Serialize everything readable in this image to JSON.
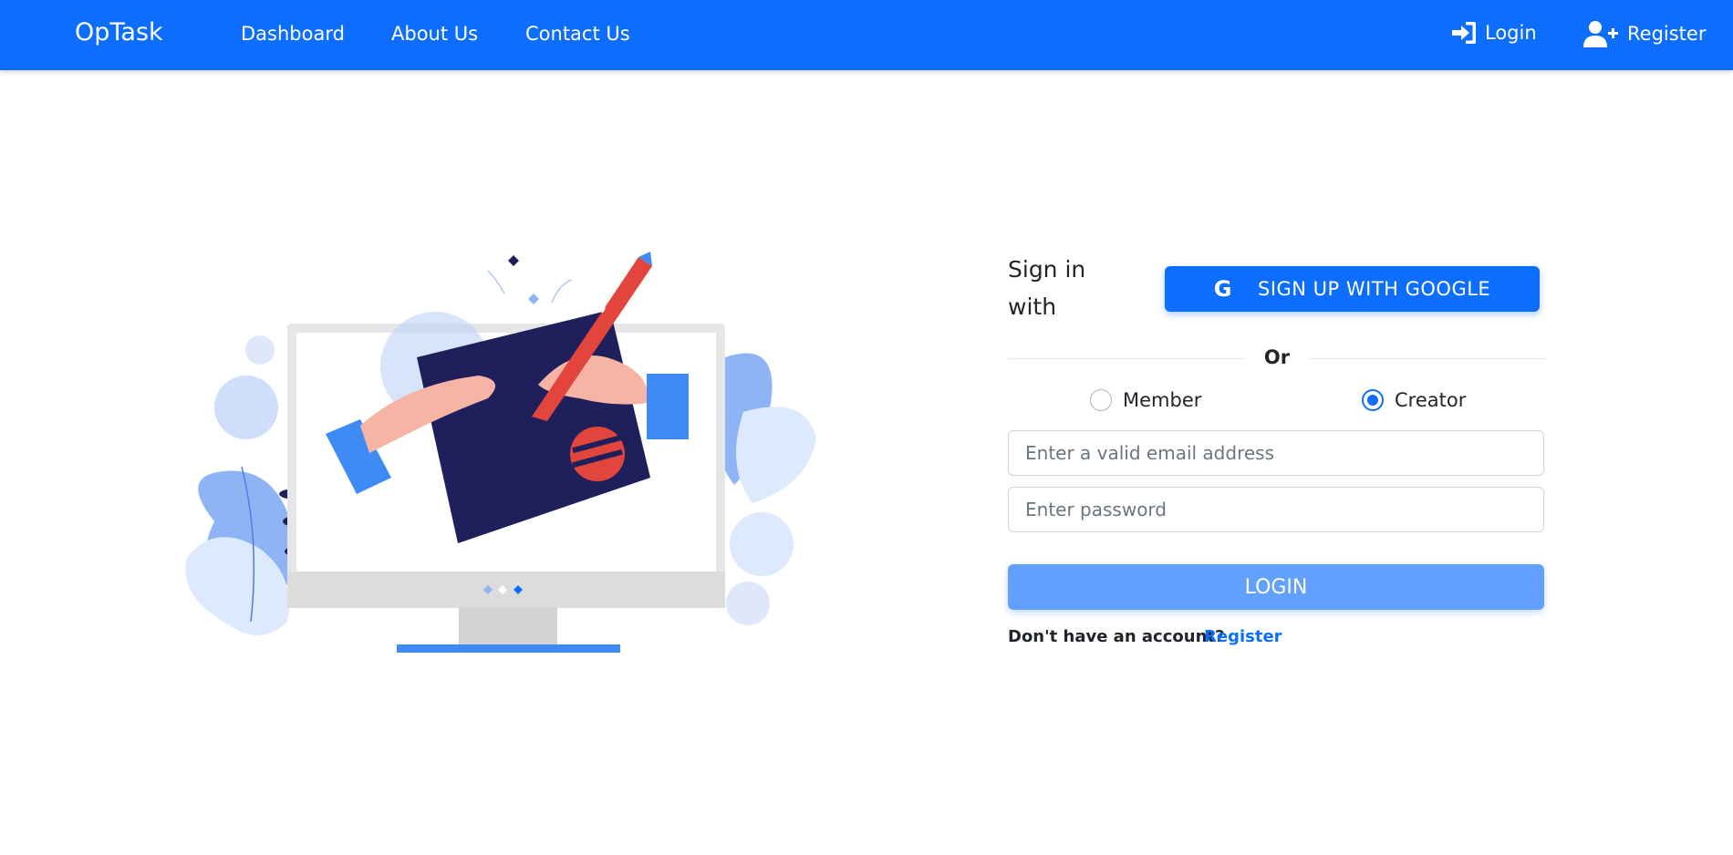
{
  "nav": {
    "brand": "OpTask",
    "links": [
      "Dashboard",
      "About Us",
      "Contact Us"
    ],
    "login_label": "Login",
    "register_label": "Register"
  },
  "form": {
    "signin_label": "Sign in with",
    "google_icon_letter": "G",
    "google_label": "SIGN UP WITH GOOGLE",
    "divider_text": "Or",
    "roles": [
      {
        "label": "Member",
        "checked": false
      },
      {
        "label": "Creator",
        "checked": true
      }
    ],
    "email_placeholder": "Enter a valid email address",
    "password_placeholder": "Enter password",
    "login_button": "LOGIN",
    "no_account_text": "Don't have an account?",
    "register_link": "Register"
  },
  "colors": {
    "primary": "#0d6efd",
    "login_button": "#61a0ff",
    "illustration_dark": "#1f1f5c",
    "illustration_red": "#e2453c"
  }
}
